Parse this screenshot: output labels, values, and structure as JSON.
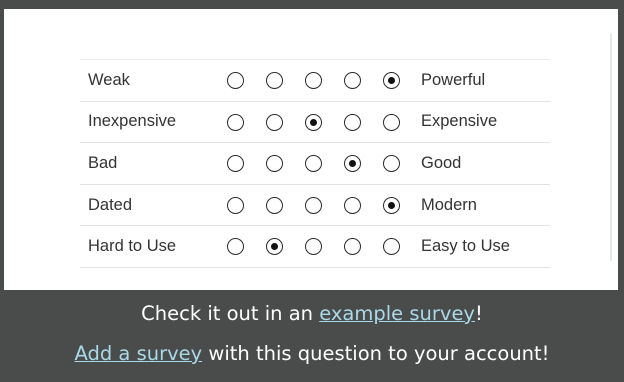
{
  "matrix": {
    "scale_points": 5,
    "rows": [
      {
        "left": "Weak",
        "right": "Powerful",
        "selected": 5
      },
      {
        "left": "Inexpensive",
        "right": "Expensive",
        "selected": 3
      },
      {
        "left": "Bad",
        "right": "Good",
        "selected": 4
      },
      {
        "left": "Dated",
        "right": "Modern",
        "selected": 5
      },
      {
        "left": "Hard to Use",
        "right": "Easy to Use",
        "selected": 2
      }
    ]
  },
  "footer": {
    "line1_prefix": "Check it out in an ",
    "line1_link": "example survey",
    "line1_suffix": "!",
    "line2_link": "Add a survey",
    "line2_suffix": " with this question to your account!",
    "link_color": "#a9d9e8",
    "background": "#4a4b4b"
  }
}
